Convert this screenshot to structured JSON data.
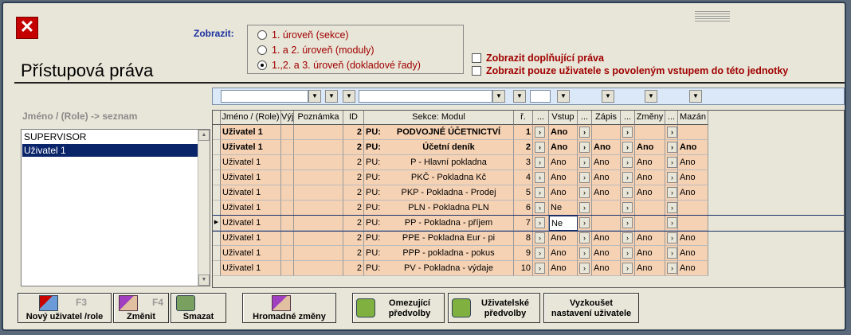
{
  "window": {
    "close_glyph": "✕",
    "title": "Přístupová práva"
  },
  "display": {
    "label": "Zobrazit:",
    "options": [
      "1. úroveň (sekce)",
      "1. a 2. úroveň (moduly)",
      "1.,2. a 3. úroveň (dokladové řady)"
    ],
    "selected_index": 2,
    "check_extra_rights": "Zobrazit doplňující práva",
    "check_only_users": "Zobrazit pouze uživatele s povoleným vstupem do této jednotky"
  },
  "left_panel": {
    "label": "Jméno / (Role) -> seznam",
    "items": [
      "SUPERVISOR",
      "Uživatel 1"
    ],
    "selected_index": 1
  },
  "grid": {
    "headers": [
      "Jméno / (Role)",
      "Výj",
      "Poznámka",
      "ID",
      "Sekce: Modul",
      "ř.",
      "...",
      "Vstup",
      "...",
      "Zápis",
      "...",
      "Změny",
      "...",
      "Mazán"
    ],
    "rows": [
      {
        "name": "Uživatel 1",
        "id": "2",
        "sec": "PU:",
        "modul": "PODVOJNÉ ÚČETNICTVÍ",
        "r": "1",
        "vstup": "Ano",
        "zapis": "",
        "zmeny": "",
        "mazani": "",
        "bold": true,
        "center": true
      },
      {
        "name": "Uživatel 1",
        "id": "2",
        "sec": "PU:",
        "modul": "Účetní deník",
        "r": "2",
        "vstup": "Ano",
        "zapis": "Ano",
        "zmeny": "Ano",
        "mazani": "Ano",
        "bold": true,
        "center": true
      },
      {
        "name": "Uživatel 1",
        "id": "2",
        "sec": "PU:",
        "modul": "P  - Hlavní pokladna",
        "r": "3",
        "vstup": "Ano",
        "zapis": "Ano",
        "zmeny": "Ano",
        "mazani": "Ano"
      },
      {
        "name": "Uživatel 1",
        "id": "2",
        "sec": "PU:",
        "modul": "PKČ - Pokladna Kč",
        "r": "4",
        "vstup": "Ano",
        "zapis": "Ano",
        "zmeny": "Ano",
        "mazani": "Ano"
      },
      {
        "name": "Uživatel 1",
        "id": "2",
        "sec": "PU:",
        "modul": "PKP - Pokladna - Prodej",
        "r": "5",
        "vstup": "Ano",
        "zapis": "Ano",
        "zmeny": "Ano",
        "mazani": "Ano"
      },
      {
        "name": "Uživatel 1",
        "id": "2",
        "sec": "PU:",
        "modul": "PLN - Pokladna PLN",
        "r": "6",
        "vstup": "Ne",
        "zapis": "",
        "zmeny": "",
        "mazani": ""
      },
      {
        "name": "Uživatel 1",
        "id": "2",
        "sec": "PU:",
        "modul": "PP  - Pokladna - příjem",
        "r": "7",
        "vstup": "Ne",
        "zapis": "",
        "zmeny": "",
        "mazani": "",
        "current": true
      },
      {
        "name": "Uživatel 1",
        "id": "2",
        "sec": "PU:",
        "modul": "PPE - Pokladna Eur - pi",
        "r": "8",
        "vstup": "Ano",
        "zapis": "Ano",
        "zmeny": "Ano",
        "mazani": "Ano"
      },
      {
        "name": "Uživatel 1",
        "id": "2",
        "sec": "PU:",
        "modul": "PPP - pokladna - pokus",
        "r": "9",
        "vstup": "Ano",
        "zapis": "Ano",
        "zmeny": "Ano",
        "mazani": "Ano"
      },
      {
        "name": "Uživatel 1",
        "id": "2",
        "sec": "PU:",
        "modul": "PV  - Pokladna - výdaje",
        "r": "10",
        "vstup": "Ano",
        "zapis": "Ano",
        "zmeny": "Ano",
        "mazani": "Ano"
      }
    ]
  },
  "buttons": {
    "new_user": "Nový uživatel /role",
    "new_user_key": "F3",
    "edit": "Změnit",
    "edit_key": "F4",
    "delete": "Smazat",
    "mass_changes": "Hromadné změny",
    "restricting_prefs_1": "Omezující",
    "restricting_prefs_2": "předvolby",
    "user_prefs_1": "Uživatelské",
    "user_prefs_2": "předvolby",
    "try_settings_1": "Vyzkoušet",
    "try_settings_2": "nastavení uživatele"
  },
  "icons": {
    "close": "close-icon",
    "dropdown": "chevron-down-icon",
    "row_pointer": "row-pointer-icon",
    "ellipsis": "ellipsis-button"
  },
  "colors": {
    "row_fill": "#f6d2b4",
    "accent_red": "#a00000",
    "label_blue": "#1a2fa0"
  }
}
